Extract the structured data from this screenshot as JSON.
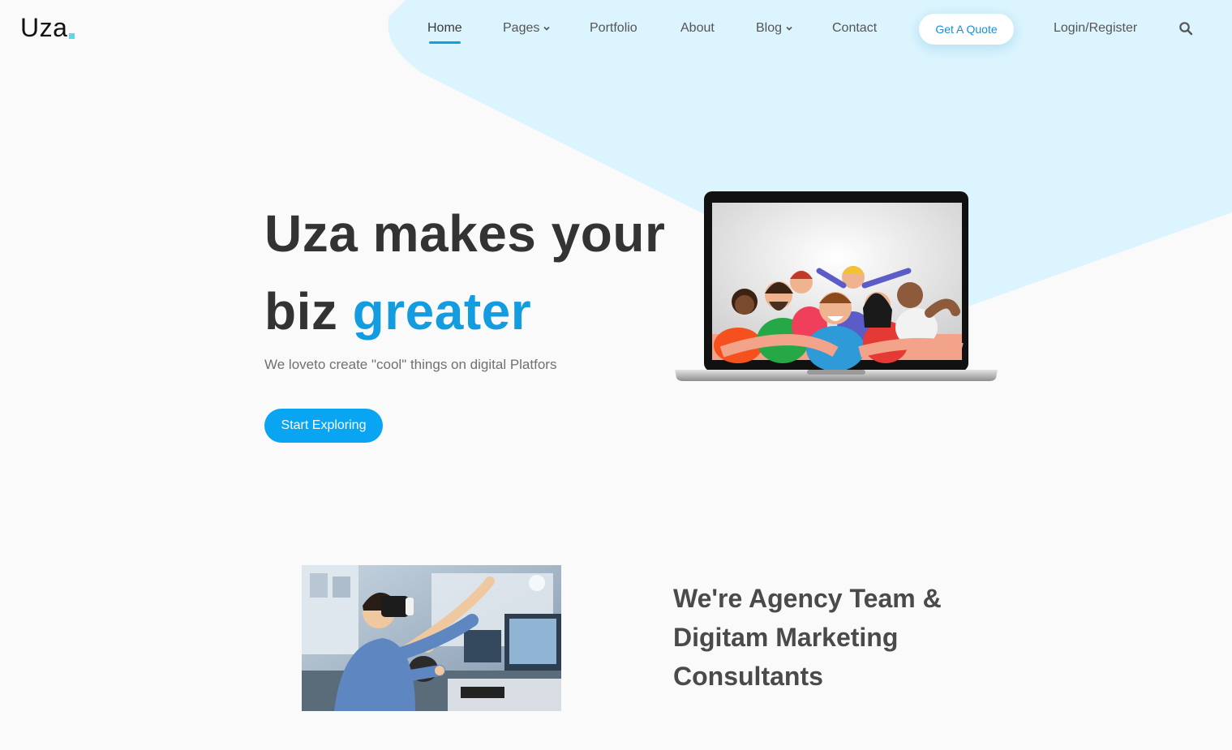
{
  "brand": {
    "logo_text": "Uza",
    "accent_color": "#5ad8e8"
  },
  "nav": {
    "items": [
      {
        "label": "Home",
        "active": true,
        "has_dropdown": false
      },
      {
        "label": "Pages",
        "active": false,
        "has_dropdown": true
      },
      {
        "label": "Portfolio",
        "active": false,
        "has_dropdown": false
      },
      {
        "label": "About",
        "active": false,
        "has_dropdown": false
      },
      {
        "label": "Blog",
        "active": false,
        "has_dropdown": true
      },
      {
        "label": "Contact",
        "active": false,
        "has_dropdown": false
      }
    ],
    "quote_button": "Get A Quote",
    "login_label": "Login/Register",
    "search_icon": "search-icon"
  },
  "hero": {
    "title_line1": "Uza makes your",
    "title_line2_plain": "biz ",
    "title_line2_accent": "greater",
    "subtitle": "We loveto create \"cool\" things on digital Platfors",
    "cta_label": "Start Exploring",
    "image": "laptop-team-illustration"
  },
  "about": {
    "image": "vr-headset-office-photo",
    "title": "We're Agency Team & Digitam Marketing Consultants"
  },
  "colors": {
    "primary": "#09a4f2",
    "accent_text": "#139ce0",
    "bg_shape": "#dcf4fd",
    "page_bg": "#fafafa"
  }
}
